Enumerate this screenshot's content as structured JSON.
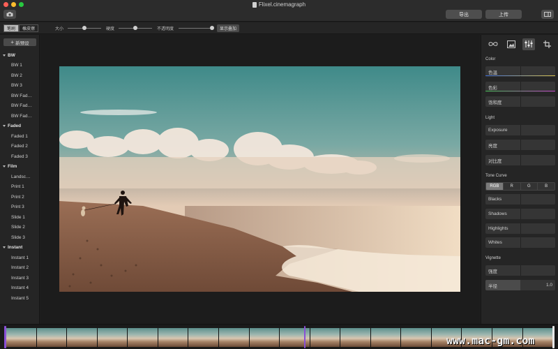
{
  "window": {
    "title": "Flixel.cinemagraph",
    "export_label": "导出",
    "upload_label": "上传"
  },
  "toolbar": {
    "mode_brush": "笔刷",
    "mode_eraser": "橡皮擦",
    "size_label": "大小",
    "hardness_label": "硬度",
    "opacity_label": "不透明度",
    "show_overlay_label": "显示叠加"
  },
  "presets": {
    "new_label": "新预设",
    "groups": [
      {
        "name": "BW",
        "items": [
          "BW 1",
          "BW 2",
          "BW 3",
          "BW Fad…",
          "BW Fad…",
          "BW Fad…"
        ]
      },
      {
        "name": "Faded",
        "items": [
          "Faded 1",
          "Faded 2",
          "Faded 3"
        ]
      },
      {
        "name": "Film",
        "items": [
          "Landsc…",
          "Print 1",
          "Print 2",
          "Print 3",
          "Slide 1",
          "Slide 2",
          "Slide 3"
        ]
      },
      {
        "name": "Instant",
        "items": [
          "Instant 1",
          "Instant 2",
          "Instant 3",
          "Instant 4",
          "Instant 5"
        ]
      }
    ]
  },
  "adjust": {
    "color_section": "Color",
    "hue": "色温",
    "tint": "色彩",
    "saturation": "饱和度",
    "light_section": "Light",
    "exposure": "Exposure",
    "brightness": "亮度",
    "contrast": "对比度",
    "tone_curve_section": "Tone Curve",
    "curve_channels": [
      "RGB",
      "R",
      "G",
      "B"
    ],
    "blacks": "Blacks",
    "shadows": "Shadows",
    "highlights": "Highlights",
    "whites": "Whites",
    "vignette_section": "Vignette",
    "vignette_strength": "强度",
    "vignette_radius": "半径",
    "vignette_radius_value": "1.0",
    "vignette_radius_fill": 0.5
  },
  "toolbar_sliders": {
    "size_value": 0.5,
    "hardness_value": 0.5,
    "opacity_value": 1.0
  },
  "watermark": "www.mac-gm.com",
  "colors": {
    "accent_purple": "#8a4fd6",
    "window_close": "#ff5f57",
    "window_min": "#febc2e",
    "window_max": "#28c840"
  },
  "icons": {
    "camera": "camera-icon",
    "panel_toggle": "panel-toggle-icon",
    "loop_tab": "infinity-icon",
    "image_tab": "image-icon",
    "adjust_tab": "sliders-icon",
    "crop_tab": "crop-icon"
  }
}
